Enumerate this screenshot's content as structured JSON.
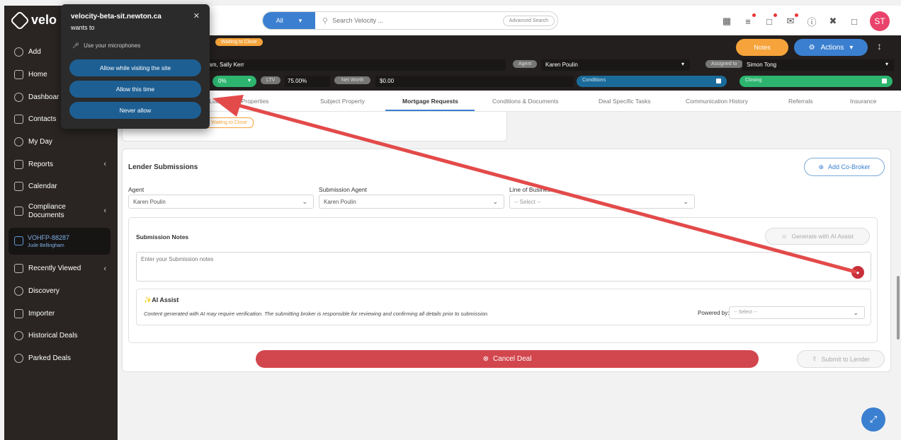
{
  "sidebar": {
    "logo_text": "velo",
    "items": [
      {
        "label": "Add"
      },
      {
        "label": "Home"
      },
      {
        "label": "Dashboar"
      },
      {
        "label": "Contacts"
      },
      {
        "label": "My Day"
      },
      {
        "label": "Reports"
      },
      {
        "label": "Calendar"
      },
      {
        "label": "Compliance"
      },
      {
        "label": "Documents"
      },
      {
        "label": "Recently Viewed"
      },
      {
        "label": "Discovery"
      },
      {
        "label": "Importer"
      },
      {
        "label": "Historical Deals"
      },
      {
        "label": "Parked Deals"
      }
    ],
    "active_deal": {
      "id": "VOHFP-88287",
      "name": "Jude Bellingham"
    }
  },
  "topbar": {
    "search_scope": "All",
    "search_placeholder": "Search Velocity ...",
    "advanced_search": "Advanced Search",
    "avatar_initials": "ST"
  },
  "deal": {
    "status": "Waiting to Close",
    "notes_label": "Notes",
    "actions_label": "Actions",
    "applicants": "ham, Sally Kerr",
    "agent_label": "Agent",
    "agent_value": "Karen Poulin",
    "assigned_label": "Assigned to",
    "assigned_value": "Simon Tong",
    "percent": "0%",
    "ltv_label": "LTV",
    "ltv_value": "75.00%",
    "net_worth_label": "Net Worth",
    "net_worth_value": "$0.00",
    "conditions_label": "Conditions",
    "closing_label": "Closing"
  },
  "tabs": [
    {
      "label": "ts, Liabilities & Properties"
    },
    {
      "label": "Subject Property"
    },
    {
      "label": "Mortgage Requests"
    },
    {
      "label": "Conditions & Documents"
    },
    {
      "label": "Deal Specific Tasks"
    },
    {
      "label": "Communication History"
    },
    {
      "label": "Referrals"
    },
    {
      "label": "Insurance"
    }
  ],
  "card_fragment_pill": "Waiting to Close",
  "lender": {
    "title": "Lender Submissions",
    "add_cobroker": "Add Co-Broker",
    "agent_label": "Agent",
    "agent_value": "Karen Poulin",
    "submission_agent_label": "Submission Agent",
    "submission_agent_value": "Karen Poulin",
    "lob_label": "Line of Business",
    "lob_value": "-- Select --",
    "notes_title": "Submission Notes",
    "generate_ai": "Generate with AI Assist",
    "notes_placeholder": "Enter your Submission notes",
    "ai_title": "AI Assist",
    "ai_note": "Content generated with AI may require verification. The submitting broker is responsible for reviewing and confirming all details prior to submission.",
    "powered_by_label": "Powered by:",
    "powered_by_value": "-- Select --",
    "cancel_deal": "Cancel Deal",
    "submit_lender": "Submit to Lender"
  },
  "permission_popup": {
    "site": "velocity-beta-sit.newton.ca",
    "wants_to": "wants to",
    "use_microphone": "Use your microphones",
    "allow_visiting": "Allow while visiting the site",
    "allow_once": "Allow this time",
    "never_allow": "Never allow"
  },
  "colors": {
    "primary_blue": "#3a7fd0",
    "orange": "#f5a33a",
    "danger_red": "#d2464d",
    "annotation_red": "#e34a4a",
    "sidebar_bg": "#2a2523"
  }
}
